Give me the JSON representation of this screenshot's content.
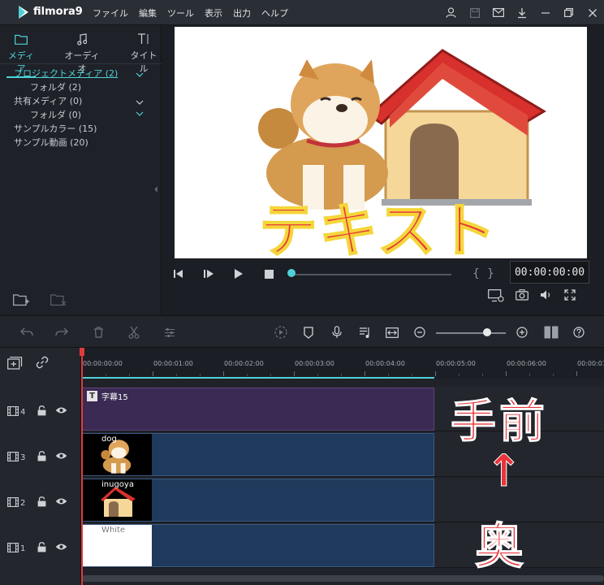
{
  "app": {
    "name": "filmora9"
  },
  "menu": [
    "ファイル",
    "編集",
    "ツール",
    "表示",
    "出力",
    "ヘルプ"
  ],
  "media_tabs": [
    {
      "label": "メディア",
      "icon": "folder-icon",
      "active": true
    },
    {
      "label": "オーディオ",
      "icon": "music-note-icon",
      "active": false
    },
    {
      "label": "タイトル",
      "icon": "title-text-icon",
      "active": false
    }
  ],
  "media_tree": [
    {
      "label": "プロジェクトメディア (2)",
      "indent": 0,
      "active": true,
      "expandable": true
    },
    {
      "label": "フォルダ (2)",
      "indent": 1,
      "active": false,
      "expandable": false
    },
    {
      "label": "共有メディア (0)",
      "indent": 0,
      "active": false,
      "expandable": true
    },
    {
      "label": "フォルダ (0)",
      "indent": 1,
      "active": false,
      "expandable": false
    },
    {
      "label": "サンプルカラー (15)",
      "indent": 0,
      "active": false,
      "expandable": false
    },
    {
      "label": "サンプル動画 (20)",
      "indent": 0,
      "active": false,
      "expandable": false
    }
  ],
  "preview": {
    "overlay_text": "テキスト",
    "timecode": "00:00:00:00",
    "brace_open": "{",
    "brace_close": "}",
    "progress": 0
  },
  "ruler": {
    "labels": [
      "00:00:00:00",
      "00:00:01:00",
      "00:00:02:00",
      "00:00:03:00",
      "00:00:04:00",
      "00:00:05:00",
      "00:00:06:00",
      "00:00:07"
    ]
  },
  "tracks": [
    {
      "number": "4",
      "clip_type": "title",
      "clip_label": "字幕15"
    },
    {
      "number": "3",
      "clip_type": "video",
      "clip_label": "dog"
    },
    {
      "number": "2",
      "clip_type": "video",
      "clip_label": "inugoya"
    },
    {
      "number": "1",
      "clip_type": "video",
      "clip_label": "White"
    }
  ],
  "annotation": {
    "top": "手前",
    "arrow": "↑",
    "bottom": "奥"
  },
  "colors": {
    "accent": "#4fd1d9",
    "playhead": "#e03b3b",
    "title_clip": "#3b2a53",
    "video_clip": "#1f3a5c",
    "annotation": "#e8343a"
  }
}
